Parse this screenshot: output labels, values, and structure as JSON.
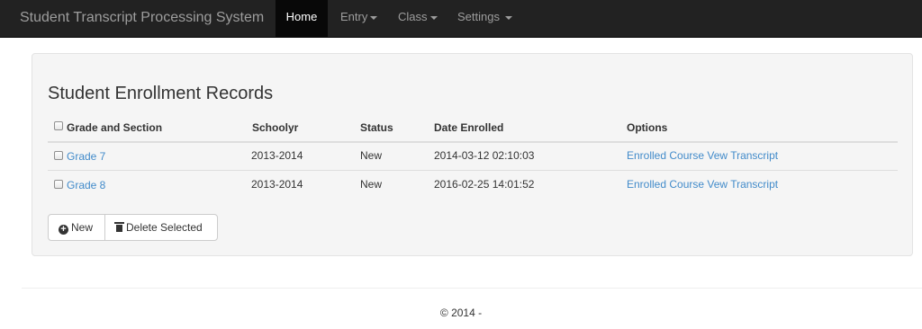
{
  "navbar": {
    "brand": "Student Transcript Processing System",
    "items": [
      {
        "label": "Home",
        "active": true,
        "dropdown": false
      },
      {
        "label": "Entry",
        "active": false,
        "dropdown": true
      },
      {
        "label": "Class",
        "active": false,
        "dropdown": true
      },
      {
        "label": "Settings",
        "active": false,
        "dropdown": true
      }
    ]
  },
  "panel": {
    "title": "Student Enrollment Records",
    "columns": [
      "Grade and Section",
      "Schoolyr",
      "Status",
      "Date Enrolled",
      "Options"
    ],
    "rows": [
      {
        "grade": "Grade 7",
        "schoolyr": "2013-2014",
        "status": "New",
        "date": "2014-03-12 02:10:03",
        "option_1": "Enrolled Course",
        "option_2": "Vew Transcript"
      },
      {
        "grade": "Grade 8",
        "schoolyr": "2013-2014",
        "status": "New",
        "date": "2016-02-25 14:01:52",
        "option_1": "Enrolled Course",
        "option_2": "Vew Transcript"
      }
    ],
    "buttons": {
      "new_label": "New",
      "delete_label": "Delete Selected",
      "new_icon": "plus-circle-icon",
      "delete_icon": "trash-icon"
    }
  },
  "footer": {
    "text": "© 2014 -"
  },
  "colors": {
    "navbar_bg": "#222222",
    "active_bg": "#080808",
    "link": "#428bca",
    "panel_bg": "#f5f5f5"
  }
}
